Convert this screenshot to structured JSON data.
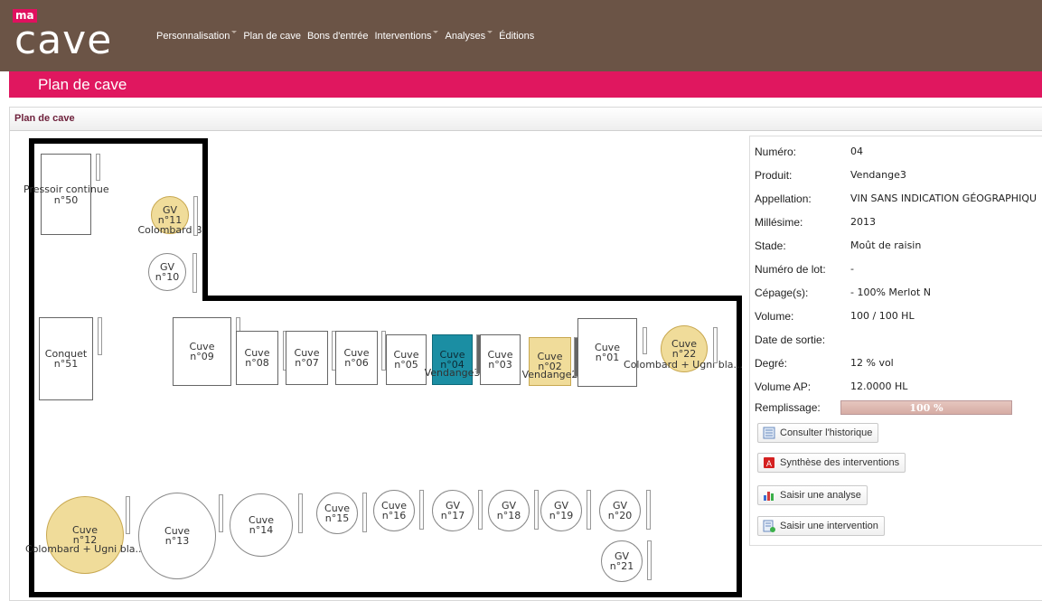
{
  "app": {
    "logo_ma": "ma",
    "logo_text": "cave"
  },
  "nav": [
    {
      "label": "Personnalisation",
      "dropdown": true
    },
    {
      "label": "Plan de cave",
      "dropdown": false
    },
    {
      "label": "Bons d'entrée",
      "dropdown": false
    },
    {
      "label": "Interventions",
      "dropdown": true
    },
    {
      "label": "Analyses",
      "dropdown": true
    },
    {
      "label": "Éditions",
      "dropdown": false
    }
  ],
  "page": {
    "title": "Plan de cave",
    "panel_title": "Plan de cave"
  },
  "tanks": {
    "t50": {
      "l1": "Pressoir continue",
      "l2": "n°50"
    },
    "t11": {
      "l1": "GV",
      "l2": "n°11",
      "prod": "Colombard B"
    },
    "t10": {
      "l1": "GV",
      "l2": "n°10"
    },
    "t51": {
      "l1": "Conquet",
      "l2": "n°51"
    },
    "t09": {
      "l1": "Cuve",
      "l2": "n°09"
    },
    "t08": {
      "l1": "Cuve",
      "l2": "n°08"
    },
    "t07": {
      "l1": "Cuve",
      "l2": "n°07"
    },
    "t06": {
      "l1": "Cuve",
      "l2": "n°06"
    },
    "t05": {
      "l1": "Cuve",
      "l2": "n°05"
    },
    "t04": {
      "l1": "Cuve",
      "l2": "n°04",
      "prod": "Vendange3"
    },
    "t03": {
      "l1": "Cuve",
      "l2": "n°03"
    },
    "t02": {
      "l1": "Cuve",
      "l2": "n°02",
      "prod": "Vendange2"
    },
    "t01": {
      "l1": "Cuve",
      "l2": "n°01"
    },
    "t22": {
      "l1": "Cuve",
      "l2": "n°22",
      "prod": "Colombard + Ugni bla..."
    },
    "t12": {
      "l1": "Cuve",
      "l2": "n°12",
      "prod": "Colombard + Ugni bla..."
    },
    "t13": {
      "l1": "Cuve",
      "l2": "n°13"
    },
    "t14": {
      "l1": "Cuve",
      "l2": "n°14"
    },
    "t15": {
      "l1": "Cuve",
      "l2": "n°15"
    },
    "t16": {
      "l1": "Cuve",
      "l2": "n°16"
    },
    "t17": {
      "l1": "GV",
      "l2": "n°17"
    },
    "t18": {
      "l1": "GV",
      "l2": "n°18"
    },
    "t19": {
      "l1": "GV",
      "l2": "n°19"
    },
    "t20": {
      "l1": "GV",
      "l2": "n°20"
    },
    "t21": {
      "l1": "GV",
      "l2": "n°21"
    }
  },
  "info": {
    "numero": {
      "label": "Numéro:",
      "value": "04"
    },
    "produit": {
      "label": "Produit:",
      "value": "Vendange3"
    },
    "appellation": {
      "label": "Appellation:",
      "value": "VIN SANS INDICATION GÉOGRAPHIQU"
    },
    "millesime": {
      "label": "Millésime:",
      "value": "2013"
    },
    "stade": {
      "label": "Stade:",
      "value": "Moût de raisin"
    },
    "lot": {
      "label": "Numéro de lot:",
      "value": "-"
    },
    "cepage": {
      "label": "Cépage(s):",
      "value": "- 100% Merlot N"
    },
    "volume": {
      "label": "Volume:",
      "value": "100 / 100 HL"
    },
    "sortie": {
      "label": "Date de sortie:",
      "value": ""
    },
    "degre": {
      "label": "Degré:",
      "value": "12 % vol"
    },
    "volume_ap": {
      "label": "Volume AP:",
      "value": "12.0000 HL"
    },
    "remplissage": {
      "label": "Remplissage:",
      "value": "100 %",
      "fraction": 1.0
    }
  },
  "actions": {
    "historique": "Consulter l'historique",
    "synthese": "Synthèse des interventions",
    "analyse": "Saisir une analyse",
    "intervention": "Saisir une intervention"
  },
  "colors": {
    "topbar": "#6b5446",
    "accent": "#e0175f",
    "selected_tank": "#1b8ea3",
    "filled_tank": "#f0dc9a"
  }
}
